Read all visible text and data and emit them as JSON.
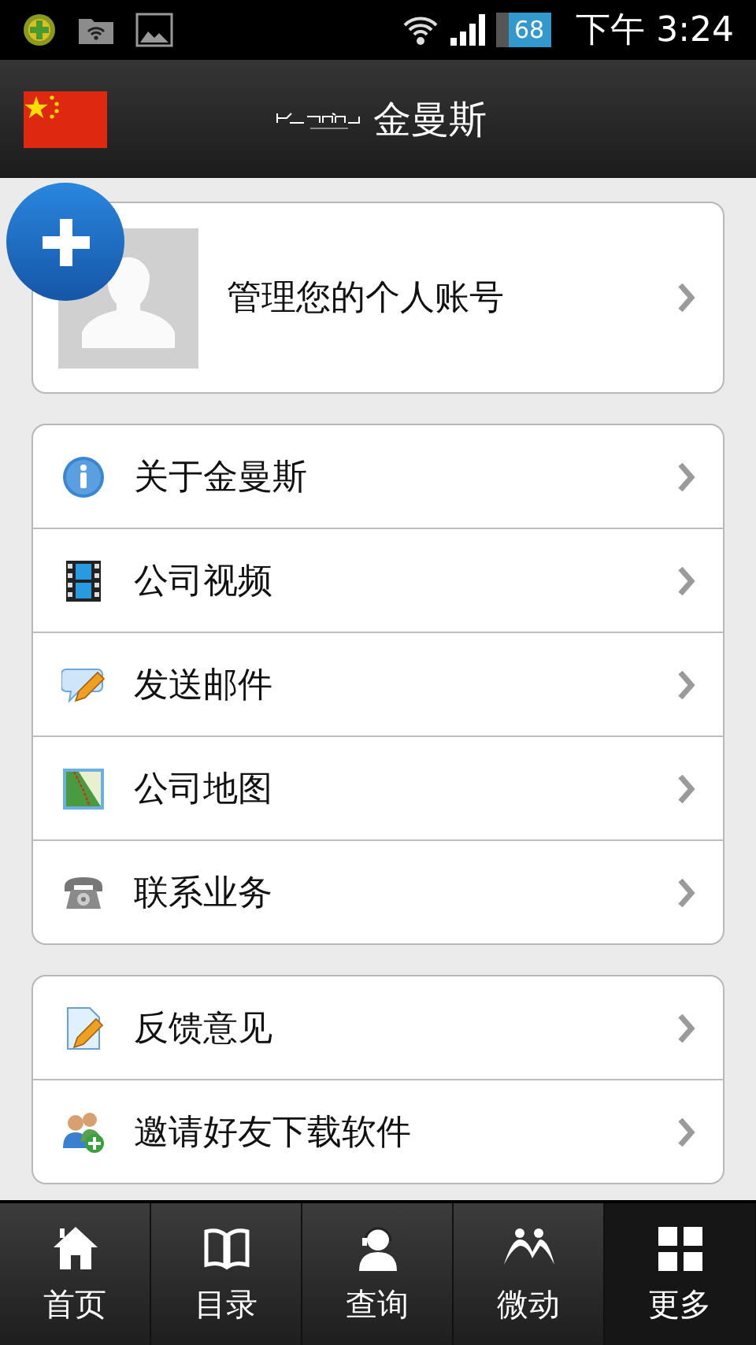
{
  "status_bar": {
    "battery": "68",
    "time": "下午 3:24"
  },
  "header": {
    "title": "金曼斯"
  },
  "account": {
    "label": "管理您的个人账号"
  },
  "menu_groups": [
    [
      {
        "label": "关于金曼斯"
      },
      {
        "label": "公司视频"
      },
      {
        "label": "发送邮件"
      },
      {
        "label": "公司地图"
      },
      {
        "label": "联系业务"
      }
    ],
    [
      {
        "label": "反馈意见"
      },
      {
        "label": "邀请好友下载软件"
      }
    ]
  ],
  "tabs": [
    {
      "label": "首页",
      "selected": false
    },
    {
      "label": "目录",
      "selected": false
    },
    {
      "label": "查询",
      "selected": false
    },
    {
      "label": "微动",
      "selected": false
    },
    {
      "label": "更多",
      "selected": true
    }
  ]
}
